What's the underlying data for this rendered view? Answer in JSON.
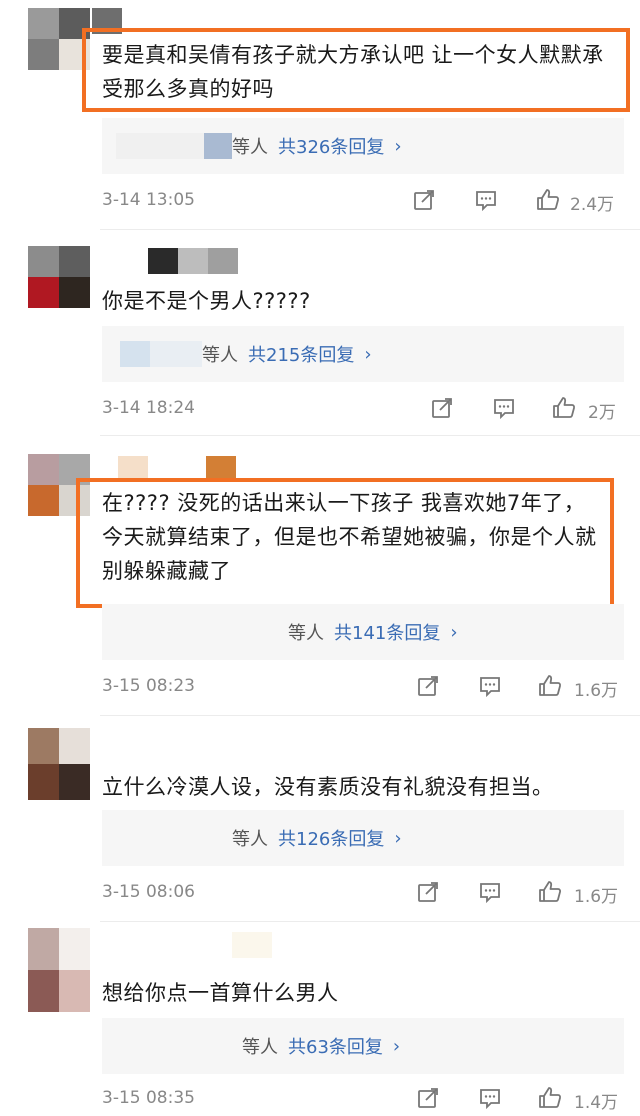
{
  "comments": [
    {
      "text": "要是真和吴倩有孩子就大方承认吧 让一个女人默默承受那么多真的好吗",
      "replies_who": "等人",
      "replies_count": "共326条回复",
      "time": "3-14 13:05",
      "likes": "2.4万"
    },
    {
      "text": "你是不是个男人?????",
      "replies_who": "等人",
      "replies_count": "共215条回复",
      "time": "3-14 18:24",
      "likes": "2万"
    },
    {
      "text": "在???? 没死的话出来认一下孩子  我喜欢她7年了，今天就算结束了，但是也不希望她被骗，你是个人就别躲躲藏藏了",
      "replies_who": "等人",
      "replies_count": "共141条回复",
      "time": "3-15 08:23",
      "likes": "1.6万"
    },
    {
      "text": "立什么冷漠人设，没有素质没有礼貌没有担当。",
      "replies_who": "等人",
      "replies_count": "共126条回复",
      "time": "3-15 08:06",
      "likes": "1.6万"
    },
    {
      "text": "想给你点一首算什么男人",
      "replies_who": "等人",
      "replies_count": "共63条回复",
      "time": "3-15 08:35",
      "likes": "1.4万"
    }
  ],
  "reply_chevron": "›",
  "icons": {
    "repost": "repost-icon",
    "comment": "comment-icon",
    "like": "like-icon"
  },
  "colors": {
    "highlight": "#f26f23",
    "link": "#3a6cb4",
    "meta": "#888888"
  }
}
